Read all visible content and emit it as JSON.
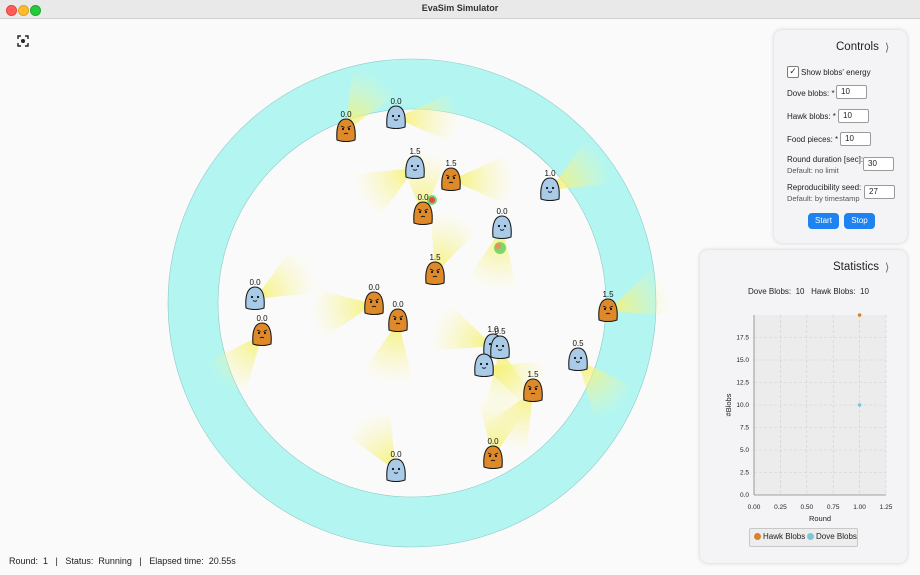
{
  "window": {
    "title": "EvaSim Simulator"
  },
  "controls": {
    "title": "Controls",
    "chevron": "⟩",
    "show_energy_label": "Show blobs' energy",
    "show_energy_checked": true,
    "dove_label": "Dove blobs: *",
    "dove_value": "10",
    "hawk_label": "Hawk blobs: *",
    "hawk_value": "10",
    "food_label": "Food pieces: *",
    "food_value": "10",
    "duration_label": "Round duration [sec]:",
    "duration_sub": "Default: no limit",
    "duration_value": "30",
    "seed_label": "Reproducibility seed:",
    "seed_sub": "Default: by timestamp",
    "seed_value": "27",
    "start_label": "Start",
    "stop_label": "Stop"
  },
  "statistics": {
    "title": "Statistics",
    "chevron": "⟩",
    "summary": "Dove Blobs:  10   Hawk Blobs:  10"
  },
  "status_bar": {
    "text": "Round:  1   |   Status:  Running   |   Elapsed time:  20.55s"
  },
  "blobs": [
    {
      "kind": "hawk",
      "energy": "0.0"
    },
    {
      "kind": "dove",
      "energy": "0.0"
    },
    {
      "kind": "dove",
      "energy": "1.5"
    },
    {
      "kind": "hawk",
      "energy": "1.5"
    },
    {
      "kind": "hawk",
      "energy": "0.0"
    },
    {
      "kind": "dove",
      "energy": "1.0"
    },
    {
      "kind": "dove",
      "energy": "0.0"
    },
    {
      "kind": "hawk",
      "energy": "1.5"
    },
    {
      "kind": "dove",
      "energy": "0.0"
    },
    {
      "kind": "hawk",
      "energy": "0.0"
    },
    {
      "kind": "hawk",
      "energy": "0.0"
    },
    {
      "kind": "hawk",
      "energy": "0.0"
    },
    {
      "kind": "hawk",
      "energy": "1.5"
    },
    {
      "kind": "dove",
      "energy": "1.0"
    },
    {
      "kind": "dove",
      "energy": "0.5"
    },
    {
      "kind": "dove",
      "energy": ""
    },
    {
      "kind": "dove",
      "energy": "0.5"
    },
    {
      "kind": "hawk",
      "energy": "1.5"
    },
    {
      "kind": "hawk",
      "energy": "0.0"
    },
    {
      "kind": "dove",
      "energy": "0.0"
    }
  ],
  "chart_data": {
    "type": "scatter",
    "xlabel": "Round",
    "ylabel": "#Blobs",
    "xlim": [
      0,
      1.25
    ],
    "ylim": [
      0,
      20
    ],
    "xticks": [
      "0.00",
      "0.25",
      "0.50",
      "0.75",
      "1.00",
      "1.25"
    ],
    "yticks": [
      "0.0",
      "2.5",
      "5.0",
      "7.5",
      "10.0",
      "12.5",
      "15.0",
      "17.5"
    ],
    "grid": true,
    "legend_position": "bottom",
    "series": [
      {
        "name": "Hawk Blobs",
        "color": "#d9822b",
        "points": [
          [
            1,
            20
          ]
        ]
      },
      {
        "name": "Dove Blobs",
        "color": "#7fc4d8",
        "points": [
          [
            1,
            10
          ]
        ]
      }
    ]
  }
}
